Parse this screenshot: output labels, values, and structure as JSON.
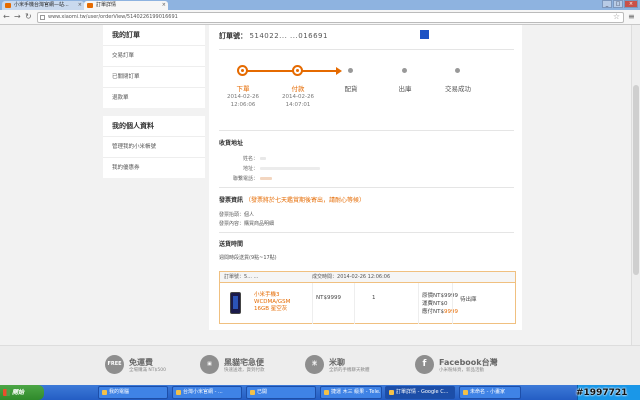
{
  "browser": {
    "tabs": [
      {
        "label": "小米手機台灣官網—站..."
      },
      {
        "label": "訂單詳情"
      }
    ],
    "url": "www.xiaomi.tw/user/orderView/5140226199016691"
  },
  "sidebar": {
    "orders_heading": "我的訂單",
    "orders_items": [
      {
        "label": "交易訂單"
      },
      {
        "label": "已關閉訂單"
      },
      {
        "label": "退款單"
      }
    ],
    "profile_heading": "我的個人資料",
    "profile_items": [
      {
        "label": "管理我的小米帳號"
      },
      {
        "label": "我的優惠券"
      }
    ]
  },
  "order": {
    "title_label": "訂單號：",
    "title_number": "514022...  ...016691"
  },
  "progress": {
    "steps": [
      {
        "label": "下單",
        "date": "2014-02-26",
        "time": "12:06:06",
        "done": true
      },
      {
        "label": "付款",
        "date": "2014-02-26",
        "time": "14:07:01",
        "done": true
      },
      {
        "label": "配貨",
        "done": false
      },
      {
        "label": "出庫",
        "done": false
      },
      {
        "label": "交易成功",
        "done": false
      }
    ]
  },
  "address": {
    "heading": "收貨地址",
    "name_label": "姓名：",
    "addr_label": "地址：",
    "phone_label": "聯繫電話："
  },
  "invoice": {
    "heading": "發票資訊",
    "notice": "（發票將於七天鑑賞期後寄出，請耐心等候）",
    "type_label": "發票抬頭：",
    "type_value": "個人",
    "content_label": "發票內容：",
    "content_value": "購買商品明細"
  },
  "delivery": {
    "heading": "送貨時間",
    "value": "週間時段送貨(9點~17點)"
  },
  "table": {
    "order_label": "訂單號：",
    "order_value": "5...  ...",
    "time_label": "成交時間：",
    "time_value": "2014-02-26 12:06:06",
    "product_name": "小米手機3 WCDMA/GSM 16GB 星空灰",
    "unit_price": "NT$9999",
    "quantity": "1",
    "total_label": "原價NT$9999",
    "shipping_label": "運費NT$0",
    "due_prefix": "應付NT$",
    "due_value": "9999",
    "status": "待出庫"
  },
  "footer": {
    "items": [
      {
        "icon": "FREE",
        "title": "免運費",
        "sub": "全場購滿 NT$500"
      },
      {
        "icon": "▣",
        "title": "黑貓宅急便",
        "sub": "快速送達，貨到付款"
      },
      {
        "icon": "米",
        "title": "米聊",
        "sub": "全新的手機聊天軟體"
      },
      {
        "icon": "f",
        "title": "Facebook台灣",
        "sub": "小米粉絲頁，新品活動"
      }
    ]
  },
  "taskbar": {
    "start_label": "開始",
    "buttons": [
      {
        "label": "我的電腦"
      },
      {
        "label": "台灣小米官網 - ..."
      },
      {
        "label": "已開"
      },
      {
        "label": "捷運 木三 級果 - Tele..."
      },
      {
        "label": "訂單詳情 - Google C..."
      },
      {
        "label": "未命名 - 小畫家"
      }
    ]
  },
  "watermark": "#1997721",
  "colors": {
    "accent": "#e56a00",
    "node_pending": "#999999"
  }
}
